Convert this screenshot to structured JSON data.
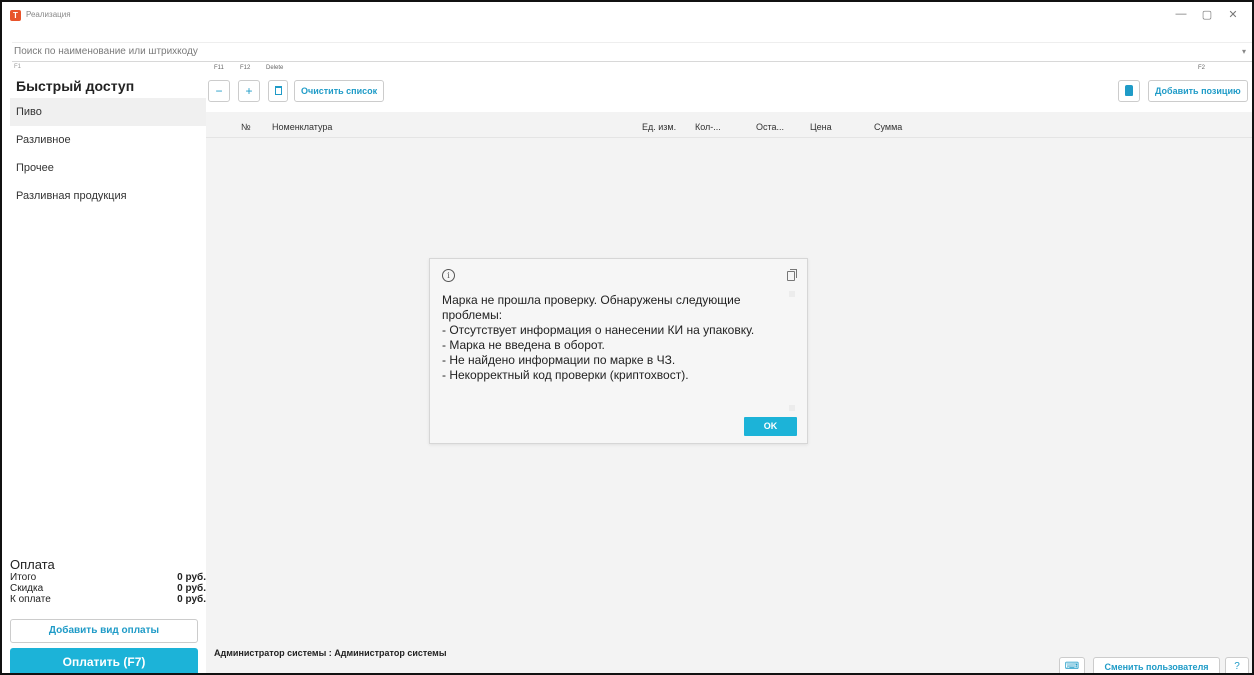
{
  "window": {
    "title": "Реализация",
    "app_icon_letter": "T",
    "controls": {
      "minimize": "—",
      "maximize": "▢",
      "close": "✕"
    }
  },
  "search": {
    "placeholder": "Поиск по наименование или штрихкоду",
    "hotkey": "F1"
  },
  "sidebar": {
    "title": "Быстрый доступ",
    "items": [
      {
        "label": "Пиво"
      },
      {
        "label": "Разливное"
      },
      {
        "label": "Прочее"
      },
      {
        "label": "Разливная продукция"
      }
    ]
  },
  "payment": {
    "title": "Оплата",
    "rows": [
      {
        "label": "Итого",
        "value": "0 руб."
      },
      {
        "label": "Скидка",
        "value": "0 руб."
      },
      {
        "label": "К оплате",
        "value": "0 руб."
      }
    ],
    "add_payment_label": "Добавить вид оплаты",
    "pay_label": "Оплатить (F7)"
  },
  "toolbar": {
    "hotkeys": {
      "minus": "F11",
      "plus": "F12",
      "delete": "Delete",
      "add": "F2"
    },
    "clear_label": "Очистить список",
    "add_position_label": "Добавить позицию"
  },
  "table": {
    "columns": [
      "№",
      "Номенклатура",
      "Ед. изм.",
      "Кол-...",
      "Оста...",
      "Цена",
      "Сумма"
    ]
  },
  "status": {
    "user_text": "Администратор системы : Администратор системы",
    "switch_user_label": "Сменить пользователя"
  },
  "dialog": {
    "message": "Марка не прошла проверку. Обнаружены следующие проблемы:\n - Отсутствует информация о нанесении КИ на упаковку.\n - Марка не введена в оборот.\n - Не найдено информации по марке в ЧЗ.\n - Некорректный код проверки (криптохвост).",
    "ok_label": "OK"
  },
  "colors": {
    "accent": "#1cb3d8",
    "accent_text": "#1f9bc7",
    "app_icon": "#e8542b"
  }
}
